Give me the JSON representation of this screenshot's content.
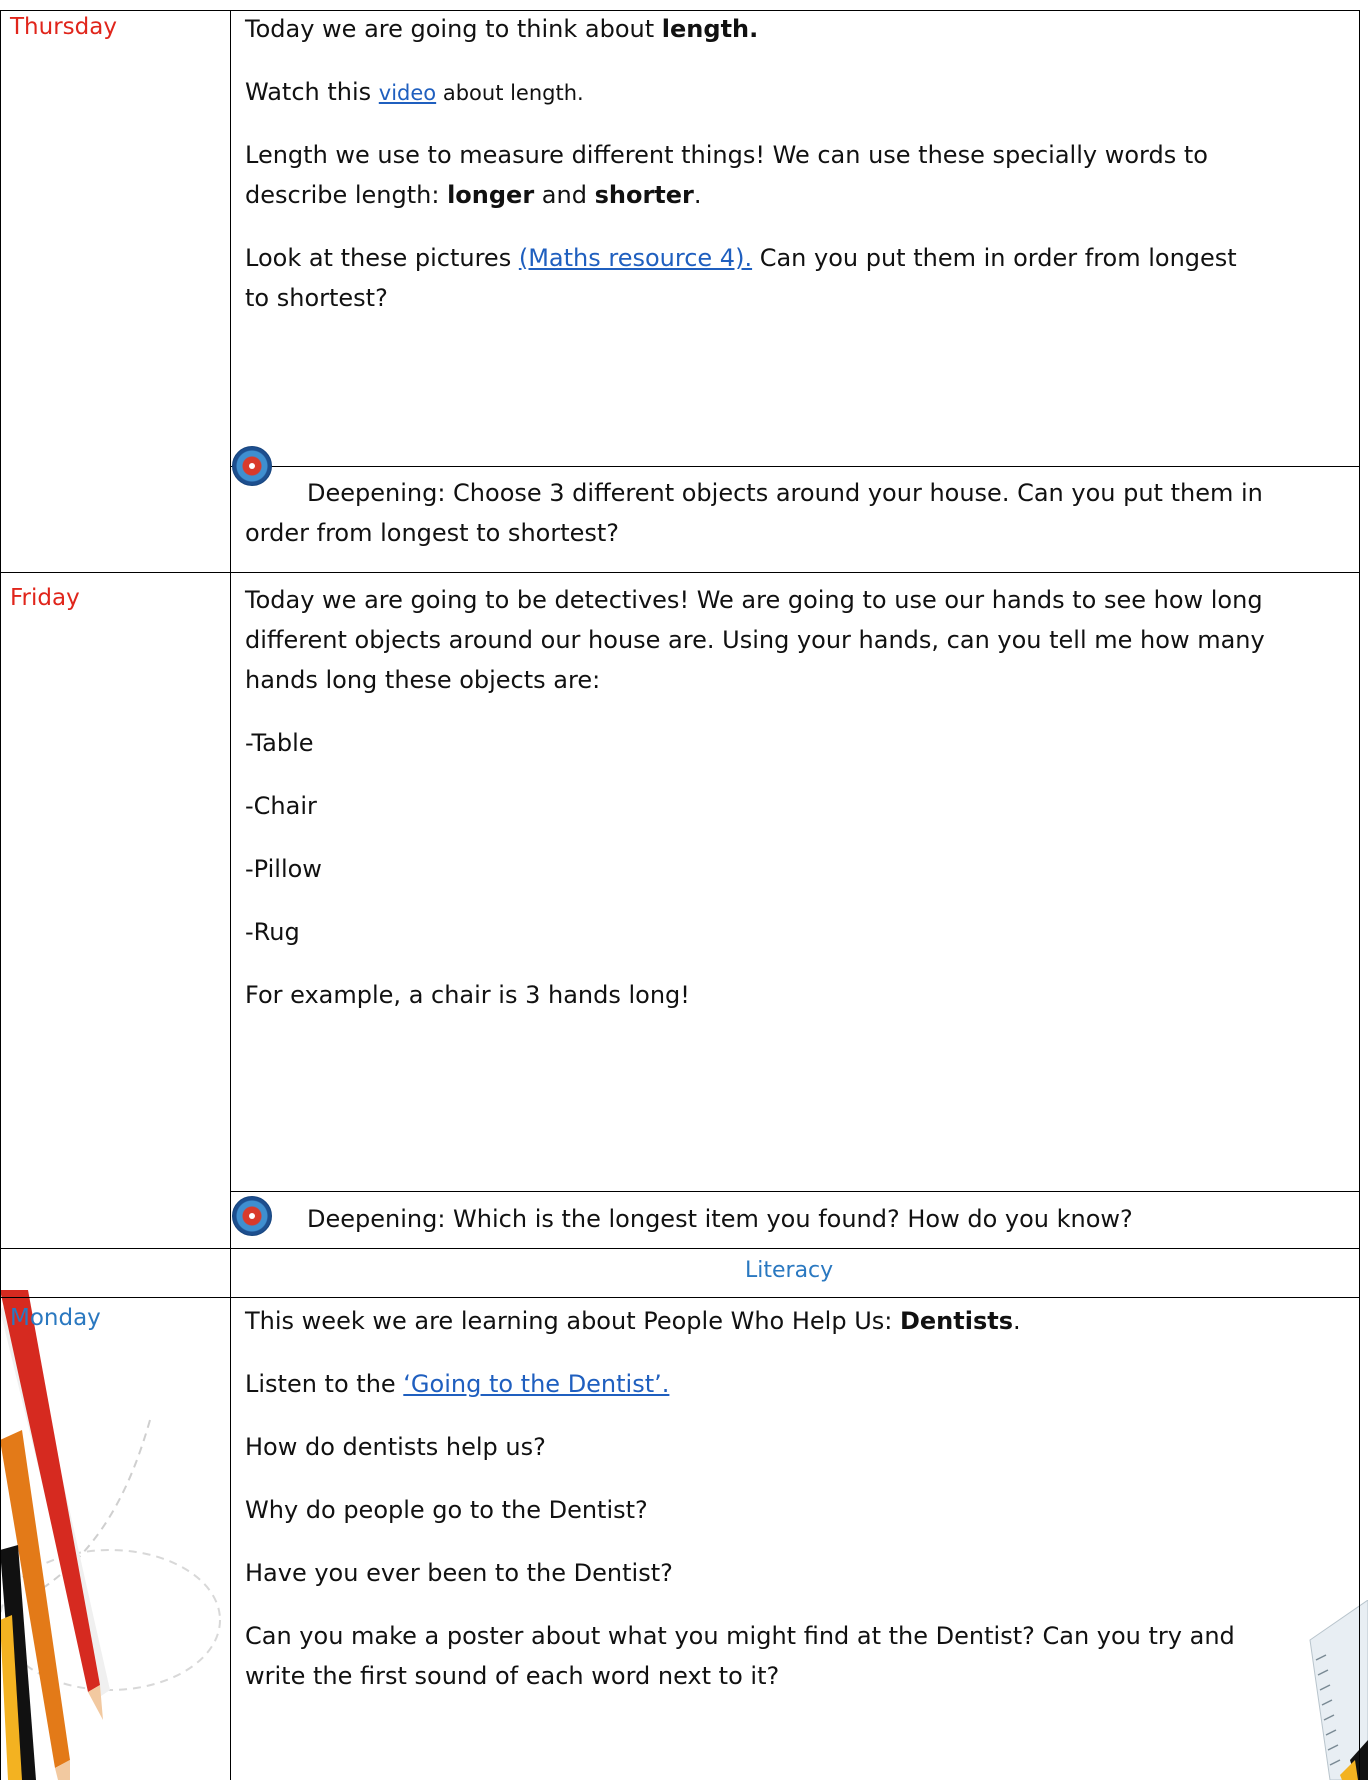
{
  "sections": {
    "thursday": {
      "day": "Thursday",
      "line1_pre": "Today we are going to think about ",
      "line1_bold": "length.",
      "line2_pre": "Watch this ",
      "line2_link": "video",
      "line2_post": " about length.",
      "line3": "Length we use to measure different things! We can use these specially words to",
      "line4_pre": "describe length: ",
      "line4_bold1": "longer",
      "line4_mid": " and ",
      "line4_bold2": "shorter",
      "line4_post": ".",
      "line5_pre": "Look at these pictures ",
      "line5_link": "(Maths resource 4).",
      "line5_post": " Can you put them in order from longest",
      "line6": "to shortest?",
      "deep1": "Deepening: Choose 3 different objects around your house. Can you put them in",
      "deep2": "order from longest to shortest?"
    },
    "friday": {
      "day": "Friday",
      "line1": "Today we are going to be detectives! We are going to use our hands to see how long",
      "line2": "different objects around our house are. Using your hands, can you tell me how many",
      "line3": "hands long these objects are:",
      "items": [
        "-Table",
        "-Chair",
        "-Pillow",
        "-Rug"
      ],
      "example": "For example, a chair is 3 hands long!",
      "deep": "Deepening: Which is the longest item you found? How do you know?"
    },
    "literacy": {
      "heading": "Literacy"
    },
    "monday": {
      "day": "Monday",
      "line1_pre": "This week we are learning about People Who Help Us: ",
      "line1_bold": "Dentists",
      "line1_post": ".",
      "line2_pre": "Listen to the ",
      "line2_link": "‘Going to the Dentist’.",
      "q1": "How do dentists help us?",
      "q2": "Why do people go to the Dentist?",
      "q3": "Have you ever been to the Dentist?",
      "q4a": "Can you make a poster about what you might find at the Dentist? Can you try and",
      "q4b": "write the first sound of each word next to it?"
    }
  }
}
